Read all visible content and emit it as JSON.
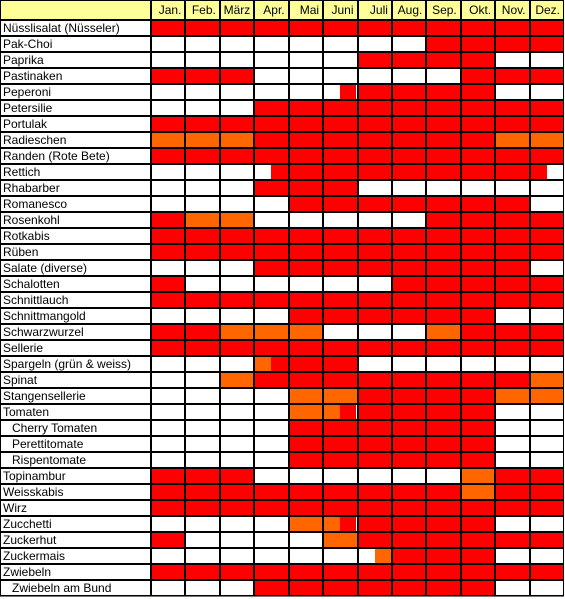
{
  "colors": {
    "none": "#FFFFFF",
    "red": "#FF0000",
    "orange": "#FF6600",
    "header": "#FFFF99"
  },
  "chart_data": {
    "type": "heatmap",
    "title": "",
    "legend_codes": {
      "W": "none",
      "R": "red",
      "O": "orange"
    },
    "months": [
      "Jan.",
      "Feb.",
      "März",
      "Apr.",
      "Mai",
      "Juni",
      "Juli",
      "Aug.",
      "Sep.",
      "Okt.",
      "Nov.",
      "Dez."
    ],
    "rows": [
      {
        "name": "Nüsslisalat (Nüsseler)",
        "indent": false,
        "cells": [
          "R",
          "R",
          "R",
          "R",
          "R",
          "R",
          "R",
          "R",
          "R",
          "R",
          "R",
          "R"
        ]
      },
      {
        "name": "Pak-Choi",
        "indent": false,
        "cells": [
          "W",
          "W",
          "W",
          "W",
          "W",
          "W",
          "W",
          "W",
          "R",
          "R",
          "R",
          "R"
        ]
      },
      {
        "name": "Paprika",
        "indent": false,
        "cells": [
          "W",
          "W",
          "W",
          "W",
          "W",
          "W",
          "R",
          "R",
          "R",
          "R",
          "W",
          "W"
        ]
      },
      {
        "name": "Pastinaken",
        "indent": false,
        "cells": [
          "R",
          "R",
          "R",
          "W",
          "W",
          "W",
          "W",
          "W",
          "W",
          "R",
          "R",
          "R"
        ]
      },
      {
        "name": "Peperoni",
        "indent": false,
        "cells": [
          "W",
          "W",
          "W",
          "W",
          "W",
          "WR",
          "R",
          "R",
          "R",
          "R",
          "W",
          "W"
        ]
      },
      {
        "name": "Petersilie",
        "indent": false,
        "cells": [
          "W",
          "W",
          "W",
          "R",
          "R",
          "R",
          "R",
          "R",
          "R",
          "R",
          "R",
          "R"
        ]
      },
      {
        "name": "Portulak",
        "indent": false,
        "cells": [
          "R",
          "R",
          "R",
          "R",
          "R",
          "R",
          "R",
          "R",
          "R",
          "R",
          "R",
          "R"
        ]
      },
      {
        "name": "Radieschen",
        "indent": false,
        "cells": [
          "O",
          "O",
          "O",
          "R",
          "R",
          "R",
          "R",
          "R",
          "R",
          "R",
          "O",
          "O"
        ]
      },
      {
        "name": "Randen (Rote Bete)",
        "indent": false,
        "cells": [
          "R",
          "R",
          "R",
          "R",
          "R",
          "R",
          "R",
          "R",
          "R",
          "R",
          "R",
          "R"
        ]
      },
      {
        "name": "Rettich",
        "indent": false,
        "cells": [
          "W",
          "W",
          "W",
          "WR",
          "R",
          "R",
          "R",
          "R",
          "R",
          "R",
          "R",
          "RW"
        ]
      },
      {
        "name": "Rhabarber",
        "indent": false,
        "cells": [
          "W",
          "W",
          "W",
          "R",
          "R",
          "R",
          "W",
          "W",
          "W",
          "W",
          "W",
          "W"
        ]
      },
      {
        "name": "Romanesco",
        "indent": false,
        "cells": [
          "W",
          "W",
          "W",
          "W",
          "R",
          "R",
          "R",
          "R",
          "R",
          "R",
          "R",
          "W"
        ]
      },
      {
        "name": "Rosenkohl",
        "indent": false,
        "cells": [
          "R",
          "O",
          "O",
          "W",
          "W",
          "W",
          "W",
          "W",
          "R",
          "R",
          "R",
          "R"
        ]
      },
      {
        "name": "Rotkabis",
        "indent": false,
        "cells": [
          "R",
          "R",
          "R",
          "R",
          "R",
          "R",
          "R",
          "R",
          "R",
          "R",
          "R",
          "R"
        ]
      },
      {
        "name": "Rüben",
        "indent": false,
        "cells": [
          "R",
          "R",
          "R",
          "R",
          "R",
          "R",
          "R",
          "R",
          "R",
          "R",
          "R",
          "R"
        ]
      },
      {
        "name": "Salate (diverse)",
        "indent": false,
        "cells": [
          "W",
          "W",
          "W",
          "R",
          "R",
          "R",
          "R",
          "R",
          "R",
          "R",
          "R",
          "W"
        ]
      },
      {
        "name": "Schalotten",
        "indent": false,
        "cells": [
          "R",
          "W",
          "W",
          "W",
          "W",
          "W",
          "W",
          "R",
          "R",
          "R",
          "R",
          "R"
        ]
      },
      {
        "name": "Schnittlauch",
        "indent": false,
        "cells": [
          "R",
          "R",
          "R",
          "R",
          "R",
          "R",
          "R",
          "R",
          "R",
          "R",
          "R",
          "R"
        ]
      },
      {
        "name": "Schnittmangold",
        "indent": false,
        "cells": [
          "W",
          "W",
          "W",
          "W",
          "R",
          "R",
          "R",
          "R",
          "R",
          "R",
          "W",
          "W"
        ]
      },
      {
        "name": "Schwarzwurzel",
        "indent": false,
        "cells": [
          "R",
          "R",
          "O",
          "O",
          "O",
          "W",
          "W",
          "W",
          "O",
          "R",
          "R",
          "R"
        ]
      },
      {
        "name": "Sellerie",
        "indent": false,
        "cells": [
          "R",
          "R",
          "R",
          "R",
          "R",
          "R",
          "R",
          "R",
          "R",
          "R",
          "R",
          "R"
        ]
      },
      {
        "name": "Spargeln (grün & weiss)",
        "indent": false,
        "cells": [
          "W",
          "W",
          "W",
          "OR",
          "R",
          "R",
          "W",
          "W",
          "W",
          "W",
          "W",
          "W"
        ]
      },
      {
        "name": "Spinat",
        "indent": false,
        "cells": [
          "W",
          "W",
          "O",
          "R",
          "R",
          "R",
          "R",
          "R",
          "R",
          "R",
          "R",
          "O"
        ]
      },
      {
        "name": "Stangensellerie",
        "indent": false,
        "cells": [
          "W",
          "W",
          "W",
          "W",
          "O",
          "O",
          "R",
          "R",
          "R",
          "R",
          "O",
          "O"
        ]
      },
      {
        "name": "Tomaten",
        "indent": false,
        "cells": [
          "W",
          "W",
          "W",
          "W",
          "O",
          "OR",
          "R",
          "R",
          "R",
          "R",
          "W",
          "W"
        ]
      },
      {
        "name": "Cherry Tomaten",
        "indent": true,
        "cells": [
          "W",
          "W",
          "W",
          "W",
          "R",
          "R",
          "R",
          "R",
          "R",
          "R",
          "W",
          "W"
        ]
      },
      {
        "name": "Perettitomate",
        "indent": true,
        "cells": [
          "W",
          "W",
          "W",
          "W",
          "R",
          "R",
          "R",
          "R",
          "R",
          "R",
          "W",
          "W"
        ]
      },
      {
        "name": "Rispentomate",
        "indent": true,
        "cells": [
          "W",
          "W",
          "W",
          "W",
          "R",
          "R",
          "R",
          "R",
          "R",
          "R",
          "W",
          "W"
        ]
      },
      {
        "name": "Topinambur",
        "indent": false,
        "cells": [
          "R",
          "R",
          "R",
          "W",
          "W",
          "W",
          "W",
          "W",
          "W",
          "O",
          "R",
          "R"
        ]
      },
      {
        "name": "Weisskabis",
        "indent": false,
        "cells": [
          "R",
          "R",
          "R",
          "R",
          "R",
          "R",
          "R",
          "R",
          "R",
          "O",
          "R",
          "R"
        ]
      },
      {
        "name": "Wirz",
        "indent": false,
        "cells": [
          "R",
          "R",
          "R",
          "R",
          "R",
          "R",
          "R",
          "R",
          "R",
          "R",
          "R",
          "R"
        ]
      },
      {
        "name": "Zucchetti",
        "indent": false,
        "cells": [
          "W",
          "W",
          "W",
          "W",
          "O",
          "OR",
          "R",
          "R",
          "R",
          "R",
          "W",
          "W"
        ]
      },
      {
        "name": "Zuckerhut",
        "indent": false,
        "cells": [
          "R",
          "W",
          "W",
          "W",
          "W",
          "O",
          "R",
          "R",
          "R",
          "R",
          "R",
          "R"
        ]
      },
      {
        "name": "Zuckermais",
        "indent": false,
        "cells": [
          "W",
          "W",
          "W",
          "W",
          "W",
          "W",
          "WO",
          "R",
          "R",
          "R",
          "W",
          "W"
        ]
      },
      {
        "name": "Zwiebeln",
        "indent": false,
        "cells": [
          "R",
          "R",
          "R",
          "R",
          "R",
          "R",
          "R",
          "R",
          "R",
          "R",
          "R",
          "R"
        ]
      },
      {
        "name": "Zwiebeln am Bund",
        "indent": true,
        "cells": [
          "W",
          "W",
          "W",
          "R",
          "R",
          "R",
          "R",
          "R",
          "R",
          "R",
          "W",
          "W"
        ]
      }
    ]
  }
}
